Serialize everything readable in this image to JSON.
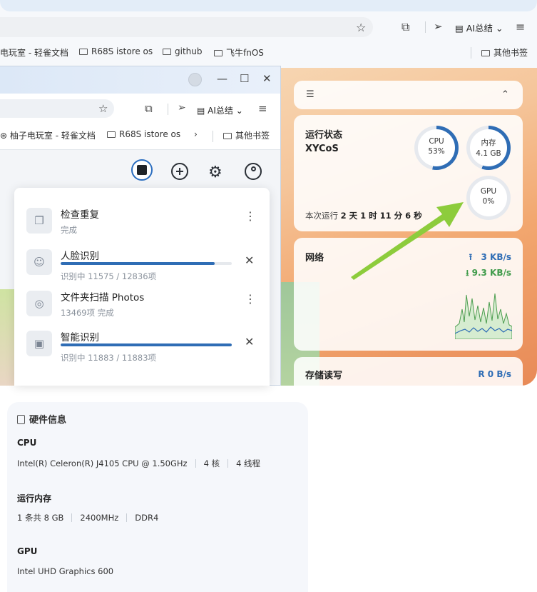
{
  "bg_browser": {
    "ai_label": "AI总结",
    "bookmarks": [
      "电玩室 - 轻雀文档",
      "R68S istore os",
      "github",
      "飞牛fnOS"
    ],
    "other_bookmarks": "其他书签"
  },
  "window": {
    "ai_label": "AI总结",
    "bookmarks": [
      "柚子电玩室 - 轻雀文档",
      "R68S istore os"
    ],
    "other_bookmarks": "其他书签"
  },
  "tasks": [
    {
      "title": "检查重复",
      "status": "完成",
      "action": "more",
      "progress": null
    },
    {
      "title": "人脸识别",
      "status": "识别中 11575 / 12836项",
      "action": "close",
      "progress": 0.9
    },
    {
      "title": "文件夹扫描 Photos",
      "status": "13469项 完成",
      "action": "more",
      "progress": null
    },
    {
      "title": "智能识别",
      "status": "识别中 11883 / 11883项",
      "action": "close",
      "progress": 1.0
    }
  ],
  "status_widget": {
    "title": "运行状态",
    "hostname": "XYCoS",
    "uptime_label": "本次运行",
    "uptime_value": "2 天 1 时 11 分 6 秒",
    "cpu": {
      "name": "CPU",
      "value": "53%",
      "fraction": 0.53
    },
    "memory": {
      "name": "内存",
      "value": "4.1 GB",
      "fraction": 0.55
    },
    "gpu": {
      "name": "GPU",
      "value": "0%",
      "fraction": 0
    }
  },
  "network_widget": {
    "title": "网络",
    "upload": "3 KB/s",
    "download": "9.3 KB/s"
  },
  "disk_widget": {
    "title": "存储读写",
    "read": "R  0 B/s"
  },
  "hardware": {
    "title": "硬件信息",
    "cpu_label": "CPU",
    "cpu_model": "Intel(R) Celeron(R) J4105 CPU @ 1.50GHz",
    "cpu_cores": "4 核",
    "cpu_threads": "4 线程",
    "ram_label": "运行内存",
    "ram_count": "1 条共 8 GB",
    "ram_speed": "2400MHz",
    "ram_type": "DDR4",
    "gpu_label": "GPU",
    "gpu_model": "Intel UHD Graphics 600"
  },
  "colors": {
    "accent_blue": "#2f6db5",
    "accent_green": "#3f9b4a",
    "arrow_green": "#8dcc3c"
  }
}
